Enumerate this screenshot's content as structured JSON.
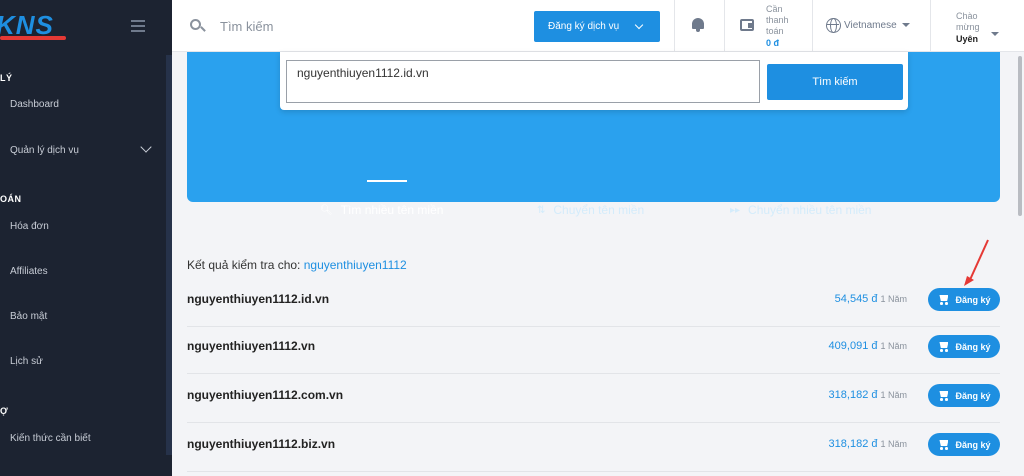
{
  "brand": {
    "name": "KNS"
  },
  "sidebar": {
    "sections": [
      {
        "title": "LÝ"
      },
      {
        "title": "OÁN"
      },
      {
        "title": "Ợ"
      }
    ],
    "items": [
      {
        "label": "Dashboard"
      },
      {
        "label": "Quản lý dịch vụ"
      },
      {
        "label": "Hóa đơn"
      },
      {
        "label": "Affiliates"
      },
      {
        "label": "Bảo mật"
      },
      {
        "label": "Lịch sử"
      },
      {
        "label": "Kiến thức cần biết"
      }
    ]
  },
  "header": {
    "search_placeholder": "Tìm kiếm",
    "register_label": "Đăng ký dịch vụ",
    "payment_label": "Cần thanh toán",
    "payment_amount": "0 đ",
    "language": "Vietnamese",
    "greeting": "Chào mừng",
    "username": "Uyên"
  },
  "domain_search": {
    "value": "nguyenthiuyen1112.id.vn",
    "button_label": "Tìm kiếm",
    "tabs": [
      {
        "label": "Tìm nhiều tên miền",
        "icon": "search-icon",
        "active": true
      },
      {
        "label": "Chuyển tên miền",
        "icon": "transfer-icon",
        "active": false
      },
      {
        "label": "Chuyển nhiều tên miền",
        "icon": "fast-forward-icon",
        "active": false
      }
    ]
  },
  "results": {
    "label": "Kết quả kiểm tra cho:",
    "keyword": "nguyenthiuyen1112",
    "rows": [
      {
        "domain": "nguyenthiuyen1112.id.vn",
        "price": "54,545 đ",
        "period": "1 Năm",
        "button": "Đăng ký"
      },
      {
        "domain": "nguyenthiuyen1112.vn",
        "price": "409,091 đ",
        "period": "1 Năm",
        "button": "Đăng ký"
      },
      {
        "domain": "nguyenthiuyen1112.com.vn",
        "price": "318,182 đ",
        "period": "1 Năm",
        "button": "Đăng ký"
      },
      {
        "domain": "nguyenthiuyen1112.biz.vn",
        "price": "318,182 đ",
        "period": "1 Năm",
        "button": "Đăng ký"
      }
    ]
  },
  "colors": {
    "accent": "#1e8fe1",
    "panel": "#2aa1ee",
    "sidebar": "#1c2331",
    "annotation_arrow": "#e53935"
  }
}
